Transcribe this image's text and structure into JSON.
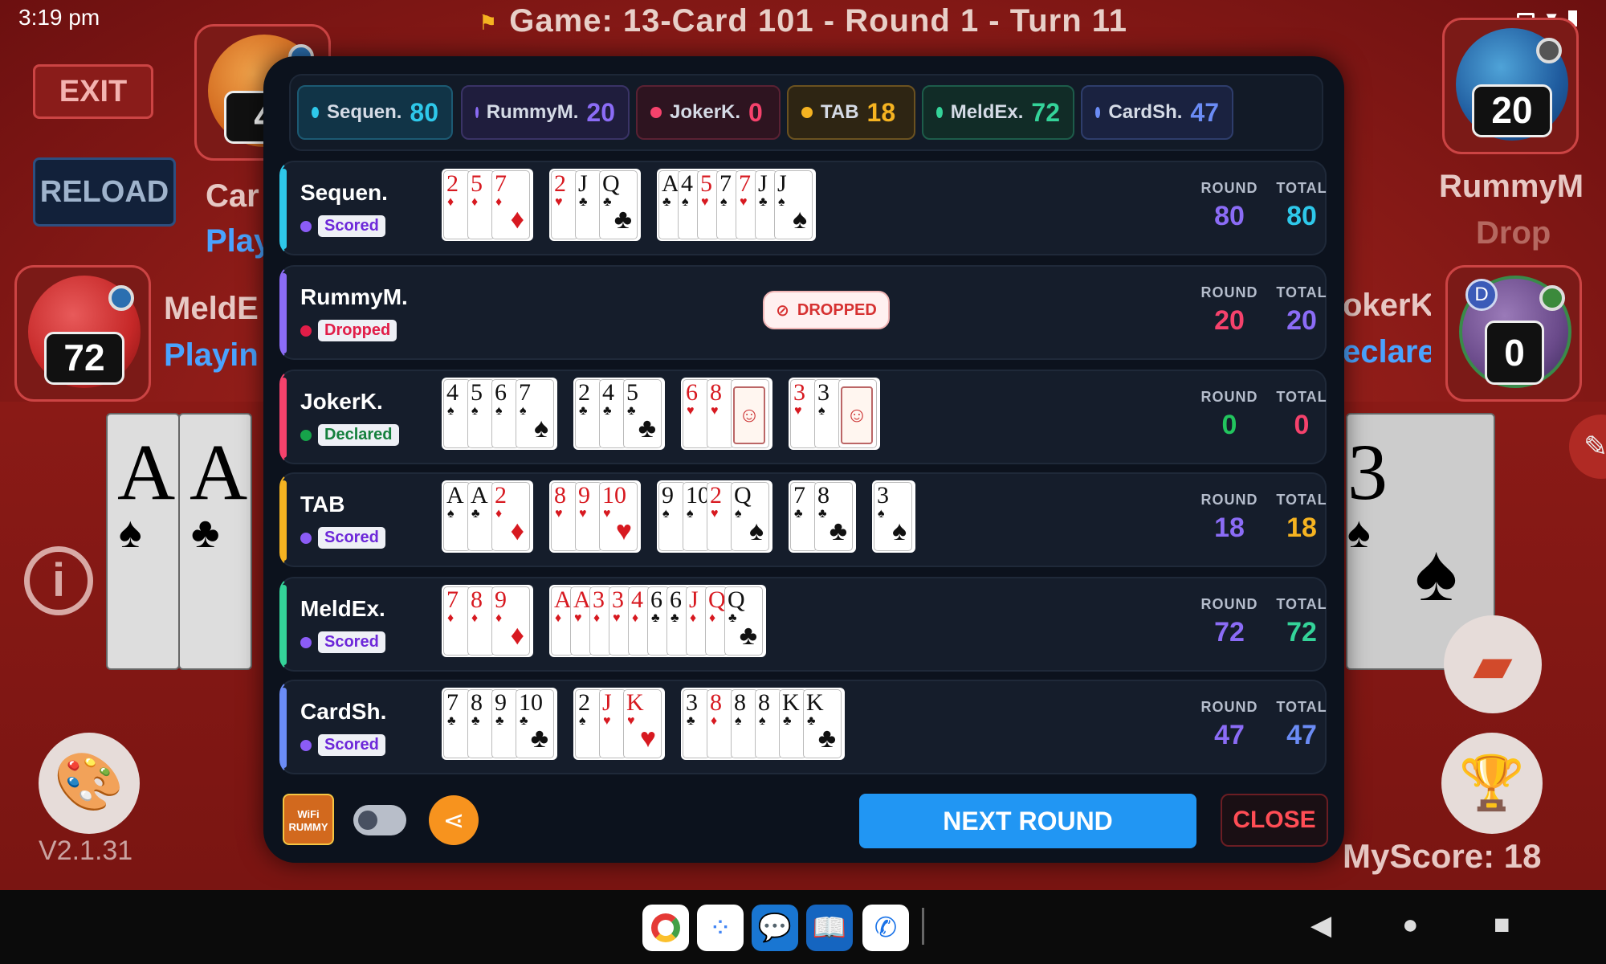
{
  "status_bar": {
    "time": "3:19 pm"
  },
  "game_title": "Game: 13-Card 101 - Round 1 - Turn 11",
  "table": {
    "exit_label": "EXIT",
    "reload_label": "RELOAD",
    "version": "V2.1.31",
    "myscore": "MyScore: 18",
    "left_avatar_top_score": "4",
    "left_avatar_top_name": "Car",
    "left_avatar_top_status": "Play",
    "left_avatar_mid_score": "72",
    "left_avatar_mid_name": "MeldE",
    "left_avatar_mid_status": "Playin",
    "right_avatar_top_score": "20",
    "right_avatar_top_name": "RummyM",
    "right_avatar_top_status": "Drop",
    "right_avatar_mid_score": "0",
    "right_avatar_mid_name": "okerK",
    "right_avatar_mid_status": "eclare",
    "right_avatar_mid_badge": "D"
  },
  "summary_chips": [
    {
      "name": "Sequen.",
      "value": "80",
      "color": "#2ec8ea",
      "bg": "#113447",
      "border": "#1c5a73"
    },
    {
      "name": "RummyM.",
      "value": "20",
      "color": "#8b6cf6",
      "bg": "#1f1d3d",
      "border": "#3a3366"
    },
    {
      "name": "JokerK.",
      "value": "0",
      "color": "#f5426c",
      "bg": "#2e1420",
      "border": "#5a2133"
    },
    {
      "name": "TAB",
      "value": "18",
      "color": "#f5b321",
      "bg": "#2e2513",
      "border": "#6b5220"
    },
    {
      "name": "MeldEx.",
      "value": "72",
      "color": "#34d399",
      "bg": "#112c27",
      "border": "#1d5c4a"
    },
    {
      "name": "CardSh.",
      "value": "47",
      "color": "#6b8cf5",
      "bg": "#1a2240",
      "border": "#2e3d6b"
    }
  ],
  "column_headers": {
    "round": "ROUND",
    "total": "TOTAL"
  },
  "players": [
    {
      "name": "Sequen.",
      "status": "Scored",
      "status_color": "#8b5cf6",
      "status_text_color": "#6d28d9",
      "accent": "#2ec8ea",
      "round": "80",
      "total": "80",
      "round_color": "#8b6cf6",
      "total_color": "#2ec8ea"
    },
    {
      "name": "RummyM.",
      "status": "Dropped",
      "status_color": "#e11d48",
      "status_text_color": "#e11d48",
      "accent": "#8b6cf6",
      "round": "20",
      "total": "20",
      "round_color": "#f5426c",
      "total_color": "#8b6cf6",
      "dropped_label": "DROPPED"
    },
    {
      "name": "JokerK.",
      "status": "Declared",
      "status_color": "#16a34a",
      "status_text_color": "#15803d",
      "accent": "#f5426c",
      "round": "0",
      "total": "0",
      "round_color": "#22c55e",
      "total_color": "#f5426c"
    },
    {
      "name": "TAB",
      "status": "Scored",
      "status_color": "#8b5cf6",
      "status_text_color": "#6d28d9",
      "accent": "#f5b321",
      "round": "18",
      "total": "18",
      "round_color": "#8b6cf6",
      "total_color": "#f5b321"
    },
    {
      "name": "MeldEx.",
      "status": "Scored",
      "status_color": "#8b5cf6",
      "status_text_color": "#6d28d9",
      "accent": "#34d399",
      "round": "72",
      "total": "72",
      "round_color": "#8b6cf6",
      "total_color": "#34d399"
    },
    {
      "name": "CardSh.",
      "status": "Scored",
      "status_color": "#8b5cf6",
      "status_text_color": "#6d28d9",
      "accent": "#6b8cf5",
      "round": "47",
      "total": "47",
      "round_color": "#8b6cf6",
      "total_color": "#6b8cf5"
    }
  ],
  "melds": [
    [
      {
        "cards": [
          [
            "2",
            "♦"
          ],
          [
            "5",
            "♦"
          ],
          [
            "7",
            "♦"
          ]
        ]
      },
      {
        "cards": [
          [
            "2",
            "♥"
          ],
          [
            "J",
            "♣"
          ],
          [
            "Q",
            "♣"
          ]
        ]
      },
      {
        "cards": [
          [
            "A",
            "♣"
          ],
          [
            "4",
            "♠"
          ],
          [
            "5",
            "♥"
          ],
          [
            "7",
            "♠"
          ],
          [
            "7",
            "♥"
          ],
          [
            "J",
            "♣"
          ],
          [
            "J",
            "♠"
          ]
        ]
      }
    ],
    [],
    [
      {
        "cards": [
          [
            "4",
            "♠"
          ],
          [
            "5",
            "♠"
          ],
          [
            "6",
            "♠"
          ],
          [
            "7",
            "♠"
          ]
        ]
      },
      {
        "cards": [
          [
            "2",
            "♣"
          ],
          [
            "4",
            "♣"
          ],
          [
            "5",
            "♣"
          ]
        ]
      },
      {
        "cards": [
          [
            "6",
            "♥"
          ],
          [
            "8",
            "♥"
          ],
          [
            "JK",
            "joker"
          ]
        ]
      },
      {
        "cards": [
          [
            "3",
            "♥"
          ],
          [
            "3",
            "♠"
          ],
          [
            "JK",
            "joker"
          ]
        ]
      }
    ],
    [
      {
        "cards": [
          [
            "A",
            "♠"
          ],
          [
            "A",
            "♣"
          ],
          [
            "2",
            "♦"
          ]
        ]
      },
      {
        "cards": [
          [
            "8",
            "♥"
          ],
          [
            "9",
            "♥"
          ],
          [
            "10",
            "♥"
          ]
        ]
      },
      {
        "cards": [
          [
            "9",
            "♠"
          ],
          [
            "10",
            "♠"
          ],
          [
            "2",
            "♥"
          ],
          [
            "Q",
            "♠"
          ]
        ]
      },
      {
        "cards": [
          [
            "7",
            "♣"
          ],
          [
            "8",
            "♣"
          ]
        ]
      },
      {
        "cards": [
          [
            "3",
            "♠"
          ]
        ]
      }
    ],
    [
      {
        "cards": [
          [
            "7",
            "♦"
          ],
          [
            "8",
            "♦"
          ],
          [
            "9",
            "♦"
          ]
        ]
      },
      {
        "cards": [
          [
            "A",
            "♦"
          ],
          [
            "A",
            "♥"
          ],
          [
            "3",
            "♦"
          ],
          [
            "3",
            "♥"
          ],
          [
            "4",
            "♦"
          ],
          [
            "6",
            "♣"
          ],
          [
            "6",
            "♣"
          ],
          [
            "J",
            "♦"
          ],
          [
            "Q",
            "♦"
          ],
          [
            "Q",
            "♣"
          ]
        ]
      }
    ],
    [
      {
        "cards": [
          [
            "7",
            "♣"
          ],
          [
            "8",
            "♣"
          ],
          [
            "9",
            "♣"
          ],
          [
            "10",
            "♣"
          ]
        ]
      },
      {
        "cards": [
          [
            "2",
            "♠"
          ],
          [
            "J",
            "♥"
          ],
          [
            "K",
            "♥"
          ]
        ]
      },
      {
        "cards": [
          [
            "3",
            "♣"
          ],
          [
            "8",
            "♦"
          ],
          [
            "8",
            "♠"
          ],
          [
            "8",
            "♠"
          ],
          [
            "K",
            "♣"
          ],
          [
            "K",
            "♣"
          ]
        ]
      }
    ]
  ],
  "footer": {
    "logo_text": "WiFi RUMMY",
    "next_round_label": "NEXT ROUND",
    "close_label": "CLOSE"
  }
}
